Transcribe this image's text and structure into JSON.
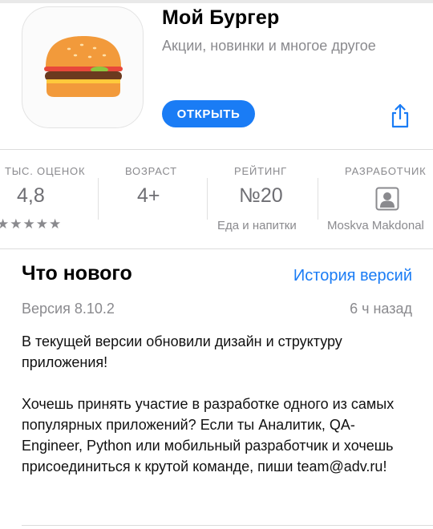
{
  "app": {
    "name": "Мой Бургер",
    "subtitle": "Акции, новинки и многое другое",
    "open_label": "ОТКРЫТЬ",
    "accent_color": "#1a7cf5",
    "icon": "burger-icon"
  },
  "stats": {
    "ratings": {
      "label": "ТЫС. ОЦЕНОК",
      "value": "4,8",
      "stars": "★★★★★"
    },
    "age": {
      "label": "ВОЗРАСТ",
      "value": "4+"
    },
    "chart": {
      "label": "РЕЙТИНГ",
      "value": "№20",
      "category": "Еда и напитки"
    },
    "developer": {
      "label": "РАЗРАБОТЧИК",
      "name": "Moskva Makdonal",
      "icon": "person-icon"
    }
  },
  "whats_new": {
    "title": "Что нового",
    "history_link": "История версий",
    "version": "Версия 8.10.2",
    "time_ago": "6 ч назад",
    "paragraphs": [
      "В текущей версии обновили дизайн и структуру приложения!",
      "Хочешь принять участие в разработке одного из самых популярных приложений? Если ты Аналитик, QA-Engineer, Python или мобильный разработчик и хочешь присоединиться к крутой команде, пиши team@adv.ru!"
    ]
  }
}
